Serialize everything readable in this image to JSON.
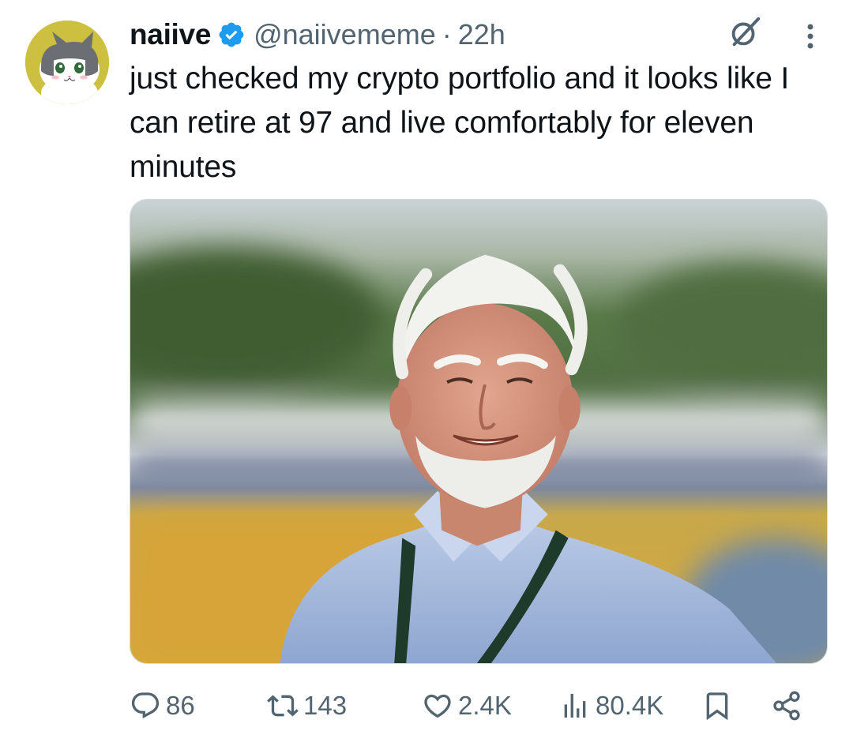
{
  "tweet": {
    "author": {
      "display_name": "naiive",
      "verified": true,
      "handle": "@naiivememe",
      "separator": "·",
      "time_ago": "22h",
      "avatar_icon": "cat-avatar-icon"
    },
    "text": "just checked my crypto portfolio and it looks like I can retire at 97 and live comfortably for eleven minutes",
    "media": {
      "type": "photo",
      "subject": "smiling elderly man with white hair and beard wearing a striped blue shirt and lanyard, blurred outdoor background"
    },
    "header_actions": {
      "grok_icon": "grok-icon",
      "more_icon": "more-vertical-icon"
    },
    "actions": {
      "reply": {
        "icon": "reply-icon",
        "count": "86"
      },
      "retweet": {
        "icon": "retweet-icon",
        "count": "143"
      },
      "like": {
        "icon": "heart-icon",
        "count": "2.4K"
      },
      "views": {
        "icon": "views-icon",
        "count": "80.4K"
      },
      "bookmark": {
        "icon": "bookmark-icon"
      },
      "share": {
        "icon": "share-icon"
      }
    }
  },
  "colors": {
    "text_primary": "#0f1419",
    "text_secondary": "#536471",
    "verified_blue": "#1d9bf0",
    "avatar_bg": "#cdbf3f"
  }
}
